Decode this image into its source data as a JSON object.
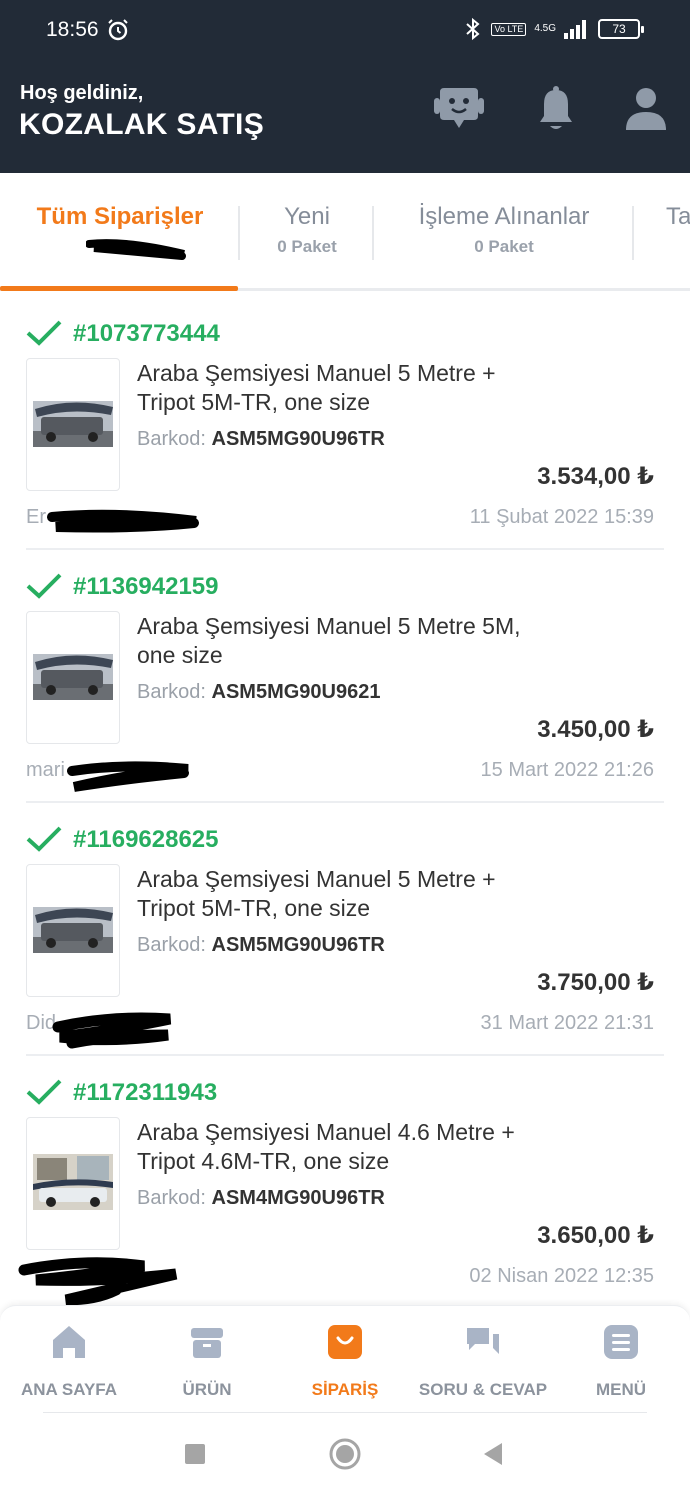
{
  "status_bar": {
    "time": "18:56",
    "network": "4.5G",
    "volte": "Vo LTE",
    "battery": "73"
  },
  "header": {
    "welcome": "Hoş geldiniz,",
    "store_name": "KOZALAK SATIŞ",
    "icons": [
      "assistant-icon",
      "bell-icon",
      "user-icon"
    ]
  },
  "tabs": [
    {
      "label": "Tüm Siparişler",
      "sub": "",
      "active": true
    },
    {
      "label": "Yeni",
      "sub": "0 Paket"
    },
    {
      "label": "İşleme Alınanlar",
      "sub": "0 Paket"
    },
    {
      "label": "Ta",
      "sub": ""
    }
  ],
  "orders": [
    {
      "number": "#1073773444",
      "product": "Araba Şemsiyesi Manuel 5 Metre + Tripot 5M-TR, one size",
      "barkod_label": "Barkod:",
      "barkod": "ASM5MG90U96TR",
      "price": "3.534,00 ₺",
      "customer": "Er",
      "date": "11 Şubat 2022 15:39"
    },
    {
      "number": "#1136942159",
      "product": "Araba Şemsiyesi Manuel 5 Metre 5M, one size",
      "barkod_label": "Barkod:",
      "barkod": "ASM5MG90U9621",
      "price": "3.450,00 ₺",
      "customer": "mari",
      "date": "15 Mart 2022 21:26"
    },
    {
      "number": "#1169628625",
      "product": "Araba Şemsiyesi Manuel 5 Metre + Tripot 5M-TR, one size",
      "barkod_label": "Barkod:",
      "barkod": "ASM5MG90U96TR",
      "price": "3.750,00 ₺",
      "customer": "Did",
      "date": "31 Mart 2022 21:31"
    },
    {
      "number": "#1172311943",
      "product": "Araba Şemsiyesi Manuel 4.6 Metre + Tripot 4.6M-TR, one size",
      "barkod_label": "Barkod:",
      "barkod": "ASM4MG90U96TR",
      "price": "3.650,00 ₺",
      "customer": "",
      "date": "02 Nisan 2022 12:35"
    }
  ],
  "bottom_nav": [
    {
      "label": "ANA SAYFA",
      "icon": "home-icon"
    },
    {
      "label": "ÜRÜN",
      "icon": "box-icon"
    },
    {
      "label": "SİPARİŞ",
      "icon": "shopping-bag-icon",
      "active": true
    },
    {
      "label": "SORU & CEVAP",
      "icon": "chat-icon"
    },
    {
      "label": "MENÜ",
      "icon": "menu-icon"
    }
  ],
  "colors": {
    "header_bg": "#222b37",
    "accent": "#f27a1a",
    "success": "#27ae60",
    "muted": "#8c939d"
  }
}
